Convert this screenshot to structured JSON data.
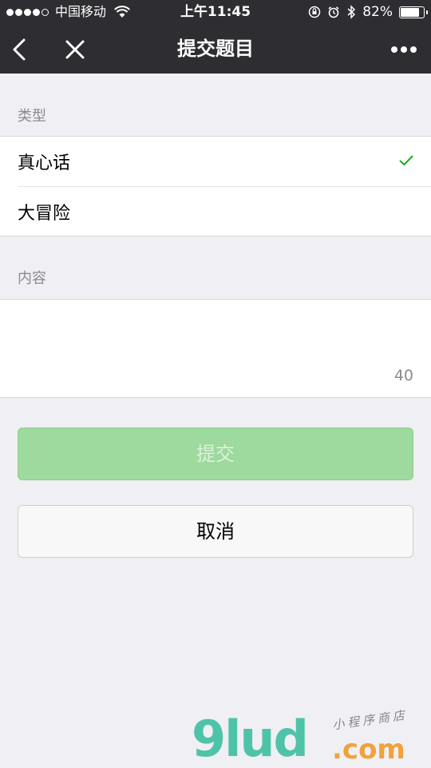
{
  "status": {
    "carrier": "中国移动",
    "time": "上午11:45",
    "battery": "82%",
    "battery_level": 0.82
  },
  "nav": {
    "title": "提交题目",
    "back_icon": "chevron-left-icon",
    "close_icon": "close-icon",
    "more_icon": "more-dots-icon"
  },
  "type_section": {
    "label": "类型",
    "options": [
      {
        "label": "真心话",
        "selected": true
      },
      {
        "label": "大冒险",
        "selected": false
      }
    ]
  },
  "content_section": {
    "label": "内容",
    "value": "",
    "counter": "40"
  },
  "buttons": {
    "submit": "提交",
    "cancel": "取消"
  },
  "watermark": {
    "logo": "9lud",
    "domain": ".com",
    "tagline": "小程序商店"
  },
  "colors": {
    "navbar": "#2e2d32",
    "background": "#efeff4",
    "check": "#1aad19",
    "submit_disabled": "#9ed99d"
  }
}
